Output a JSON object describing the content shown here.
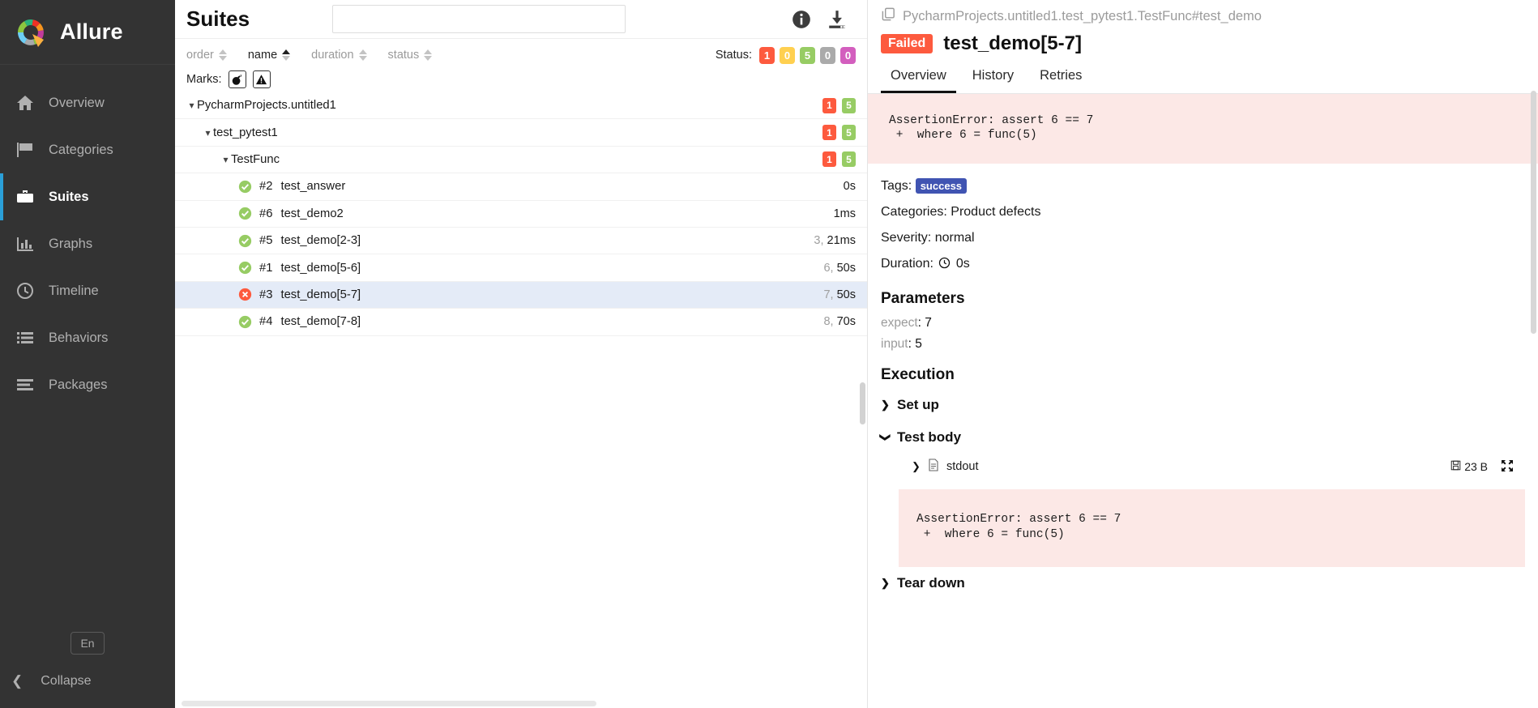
{
  "sidebar": {
    "brand": "Allure",
    "brand_logo_icon": "allure-donut-logo",
    "items": [
      {
        "label": "Overview",
        "icon": "home-icon",
        "active": false
      },
      {
        "label": "Categories",
        "icon": "flag-icon",
        "active": false
      },
      {
        "label": "Suites",
        "icon": "briefcase-icon",
        "active": true
      },
      {
        "label": "Graphs",
        "icon": "bar-chart-icon",
        "active": false
      },
      {
        "label": "Timeline",
        "icon": "clock-icon",
        "active": false
      },
      {
        "label": "Behaviors",
        "icon": "list-icon",
        "active": false
      },
      {
        "label": "Packages",
        "icon": "stack-icon",
        "active": false
      }
    ],
    "language_button": "En",
    "collapse_label": "Collapse",
    "collapse_icon": "chevron-left-icon"
  },
  "tree": {
    "title": "Suites",
    "search_value": "",
    "search_placeholder": "",
    "info_icon": "info-icon",
    "download_icon": "download-icon",
    "sorts": [
      {
        "label": "order",
        "active": false
      },
      {
        "label": "name",
        "active": true
      },
      {
        "label": "duration",
        "active": false
      },
      {
        "label": "status",
        "active": false
      }
    ],
    "status_label": "Status:",
    "status_chips": [
      {
        "value": "1",
        "color": "#fd5a3e"
      },
      {
        "value": "0",
        "color": "#ffd050"
      },
      {
        "value": "5",
        "color": "#97cc64"
      },
      {
        "value": "0",
        "color": "#aaaaaa"
      },
      {
        "value": "0",
        "color": "#d35ebe"
      }
    ],
    "marks_label": "Marks:",
    "marks": [
      {
        "icon": "bomb-icon"
      },
      {
        "icon": "warning-triangle-icon"
      }
    ],
    "rows": [
      {
        "type": "group",
        "indent": 0,
        "caret": "down",
        "label": "PycharmProjects.untitled1",
        "chips": [
          {
            "value": "1",
            "color": "#fd5a3e"
          },
          {
            "value": "5",
            "color": "#97cc64"
          }
        ]
      },
      {
        "type": "group",
        "indent": 1,
        "caret": "down",
        "label": "test_pytest1",
        "chips": [
          {
            "value": "1",
            "color": "#fd5a3e"
          },
          {
            "value": "5",
            "color": "#97cc64"
          }
        ]
      },
      {
        "type": "group",
        "indent": 2,
        "caret": "down",
        "label": "TestFunc",
        "chips": [
          {
            "value": "1",
            "color": "#fd5a3e"
          },
          {
            "value": "5",
            "color": "#97cc64"
          }
        ]
      },
      {
        "type": "test",
        "indent": 3,
        "status": "passed",
        "num": "#2",
        "label": "test_answer",
        "dur_pre": "",
        "dur": "0s",
        "selected": false
      },
      {
        "type": "test",
        "indent": 3,
        "status": "passed",
        "num": "#6",
        "label": "test_demo2",
        "dur_pre": "",
        "dur": "1ms",
        "selected": false
      },
      {
        "type": "test",
        "indent": 3,
        "status": "passed",
        "num": "#5",
        "label": "test_demo[2-3]",
        "dur_pre": "3, ",
        "dur": "21ms",
        "selected": false
      },
      {
        "type": "test",
        "indent": 3,
        "status": "passed",
        "num": "#1",
        "label": "test_demo[5-6]",
        "dur_pre": "6, ",
        "dur": "50s",
        "selected": false
      },
      {
        "type": "test",
        "indent": 3,
        "status": "failed",
        "num": "#3",
        "label": "test_demo[5-7]",
        "dur_pre": "7, ",
        "dur": "50s",
        "selected": true
      },
      {
        "type": "test",
        "indent": 3,
        "status": "passed",
        "num": "#4",
        "label": "test_demo[7-8]",
        "dur_pre": "8, ",
        "dur": "70s",
        "selected": false
      }
    ]
  },
  "detail": {
    "breadcrumb_icon": "copy-icon",
    "breadcrumb": "PycharmProjects.untitled1.test_pytest1.TestFunc#test_demo",
    "status_badge": "Failed",
    "status_badge_color": "#fd5a3e",
    "title": "test_demo[5-7]",
    "tabs": [
      {
        "label": "Overview",
        "active": true
      },
      {
        "label": "History",
        "active": false
      },
      {
        "label": "Retries",
        "active": false
      }
    ],
    "error_message": "AssertionError: assert 6 == 7\n +  where 6 = func(5)",
    "tags_label": "Tags:",
    "tags": [
      {
        "label": "success",
        "color": "#4054b2"
      }
    ],
    "categories_line": "Categories: Product defects",
    "severity_line": "Severity: normal",
    "duration_label": "Duration:",
    "duration_icon": "clock-icon",
    "duration_value": "0s",
    "parameters_heading": "Parameters",
    "parameters": [
      {
        "key": "expect",
        "value": "7"
      },
      {
        "key": "input",
        "value": "5"
      }
    ],
    "execution_heading": "Execution",
    "steps": [
      {
        "label": "Set up",
        "caret": "right"
      },
      {
        "label": "Test body",
        "caret": "down"
      }
    ],
    "attachment": {
      "caret": "right",
      "file_icon": "file-icon",
      "name": "stdout",
      "size_icon": "floppy-icon",
      "size": "23 B",
      "expand_icon": "expand-icon"
    },
    "attachment_body": "AssertionError: assert 6 == 7\n +  where 6 = func(5)",
    "teardown": {
      "label": "Tear down",
      "caret": "right"
    }
  }
}
